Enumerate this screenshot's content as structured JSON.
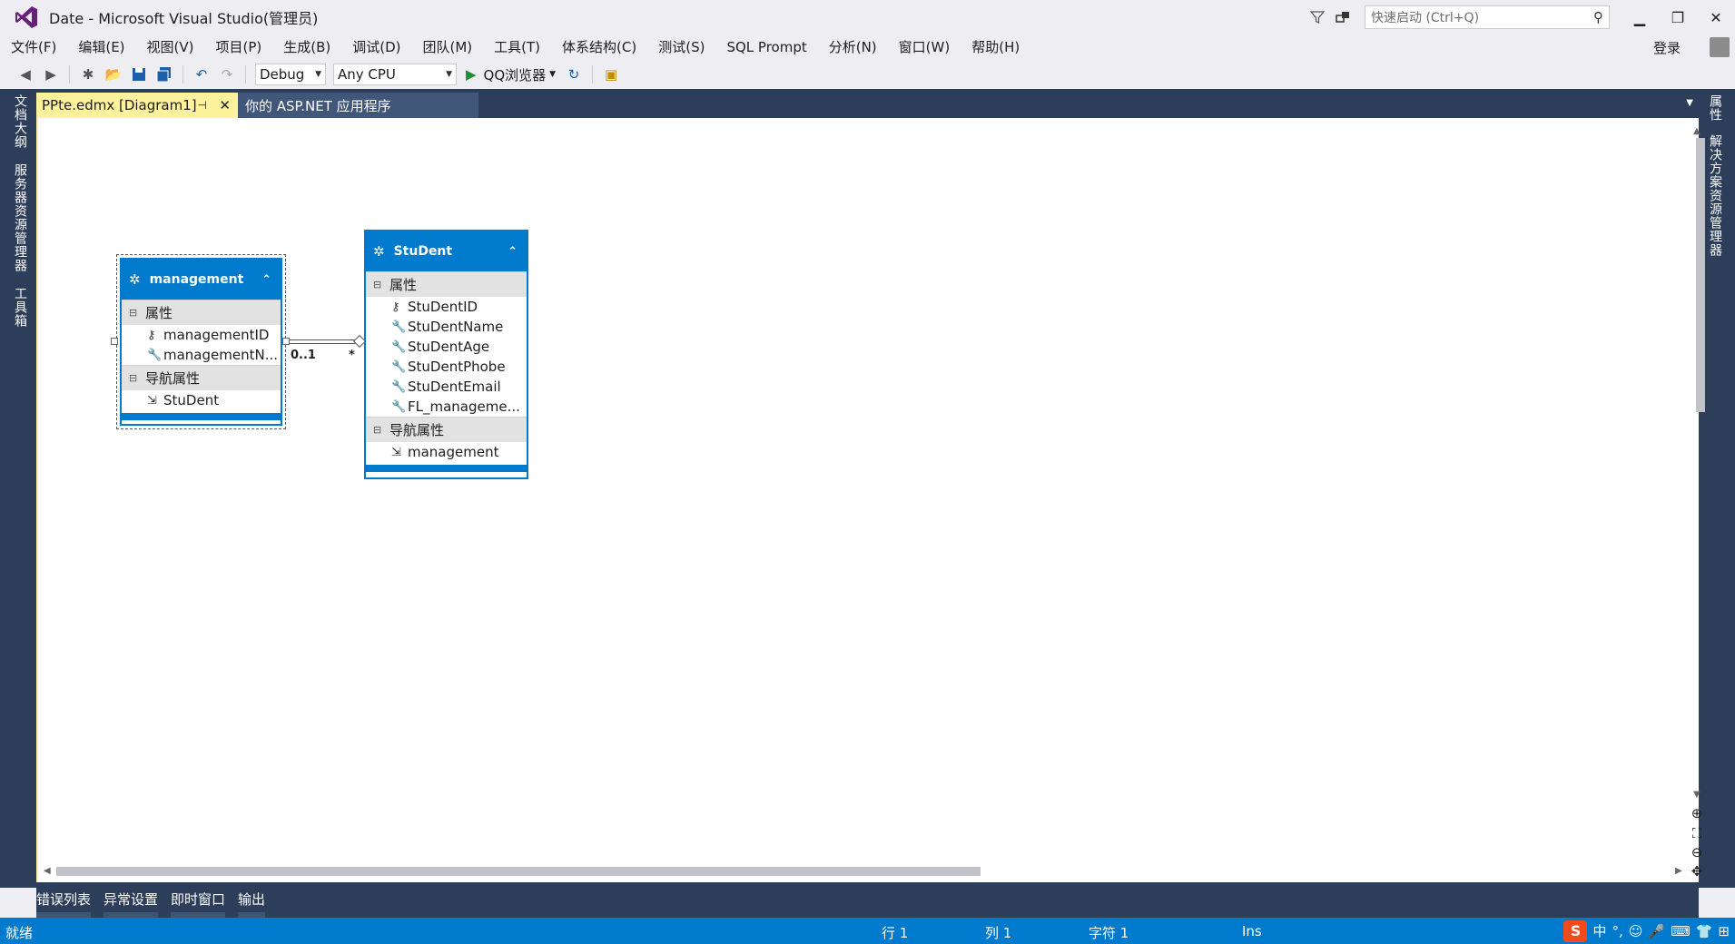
{
  "window": {
    "title": "Date - Microsoft Visual Studio(管理员)",
    "quick_launch_placeholder": "快速启动 (Ctrl+Q)",
    "login": "登录"
  },
  "menu": [
    "文件(F)",
    "编辑(E)",
    "视图(V)",
    "项目(P)",
    "生成(B)",
    "调试(D)",
    "团队(M)",
    "工具(T)",
    "体系结构(C)",
    "测试(S)",
    "SQL Prompt",
    "分析(N)",
    "窗口(W)",
    "帮助(H)"
  ],
  "toolbar": {
    "config": "Debug",
    "platform": "Any CPU",
    "run_target": "QQ浏览器"
  },
  "left_side_tabs": [
    "文档大纲",
    "服务器资源管理器",
    "工具箱"
  ],
  "right_side_tabs": [
    "属性",
    "解决方案资源管理器"
  ],
  "tabs": {
    "active": "PPte.edmx [Diagram1]",
    "inactive": "你的 ASP.NET 应用程序"
  },
  "entities": {
    "management": {
      "name": "management",
      "properties_header": "属性",
      "properties": [
        "managementID",
        "managementN..."
      ],
      "nav_header": "导航属性",
      "nav": [
        "StuDent"
      ]
    },
    "student": {
      "name": "StuDent",
      "properties_header": "属性",
      "properties": [
        "StuDentID",
        "StuDentName",
        "StuDentAge",
        "StuDentPhobe",
        "StuDentEmail",
        "FL_manageme..."
      ],
      "nav_header": "导航属性",
      "nav": [
        "management"
      ]
    }
  },
  "association": {
    "left_multiplicity": "0..1",
    "right_multiplicity": "*"
  },
  "bottom_tabs": [
    "错误列表",
    "异常设置",
    "即时窗口",
    "输出"
  ],
  "status": {
    "ready": "就绪",
    "line": "行 1",
    "col": "列 1",
    "char": "字符 1",
    "mode": "Ins",
    "ime_lang": "中"
  },
  "colors": {
    "accent": "#007acc",
    "tab_active": "#fff29d",
    "frame": "#2d3e5a"
  }
}
